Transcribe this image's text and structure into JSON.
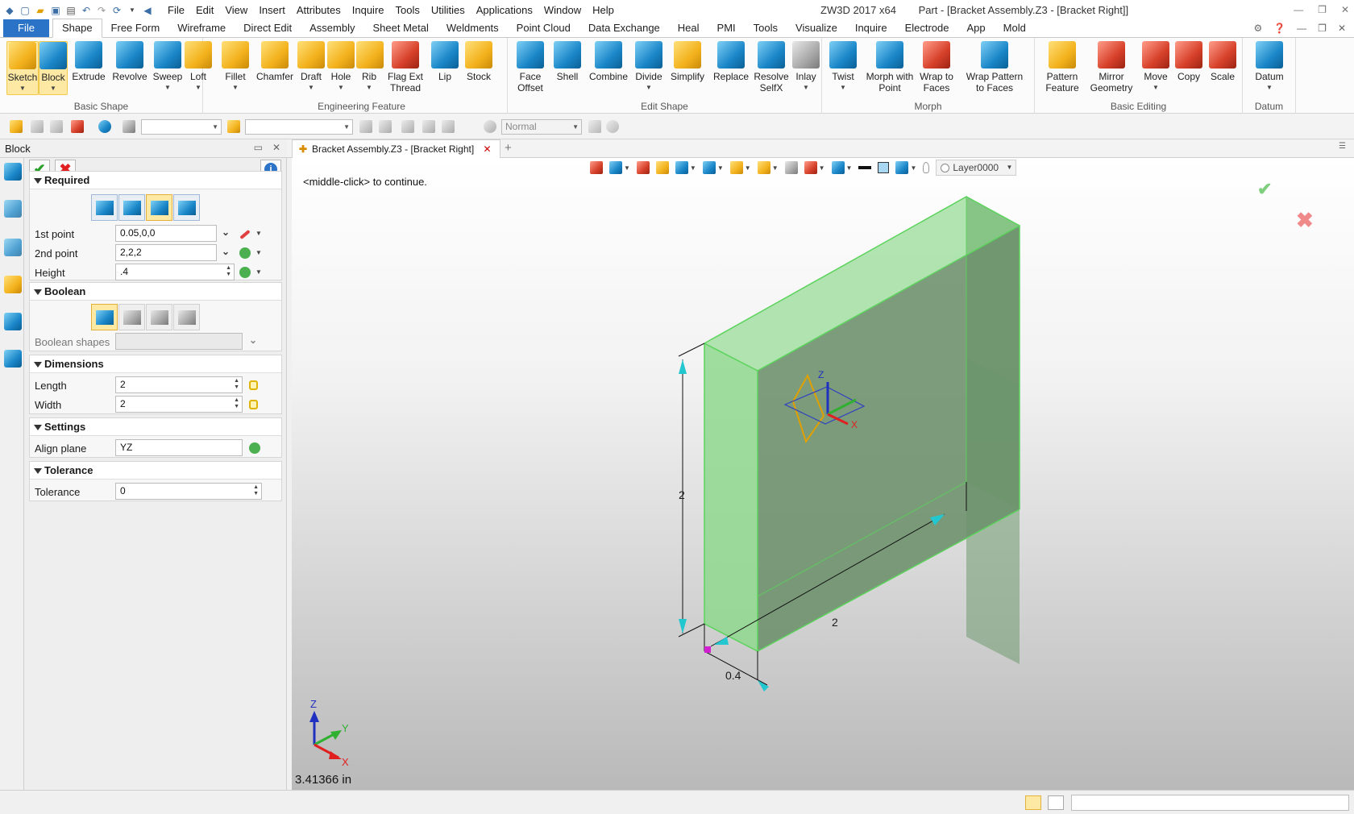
{
  "app": {
    "title": "ZW3D 2017  x64",
    "document_title": "Part - [Bracket Assembly.Z3 - [Bracket Right]]"
  },
  "menu": [
    "File",
    "Edit",
    "View",
    "Insert",
    "Attributes",
    "Inquire",
    "Tools",
    "Utilities",
    "Applications",
    "Window",
    "Help"
  ],
  "ribbon_tabs": [
    "File",
    "Shape",
    "Free Form",
    "Wireframe",
    "Direct Edit",
    "Assembly",
    "Sheet Metal",
    "Weldments",
    "Point Cloud",
    "Data Exchange",
    "Heal",
    "PMI",
    "Tools",
    "Visualize",
    "Inquire",
    "Electrode",
    "App",
    "Mold"
  ],
  "active_tab": "Shape",
  "ribbon": {
    "basic_shape": {
      "label": "Basic Shape",
      "buttons": [
        "Sketch",
        "Block",
        "Extrude",
        "Revolve",
        "Sweep",
        "Loft"
      ]
    },
    "engineering_feature": {
      "label": "Engineering Feature",
      "buttons": [
        "Fillet",
        "Chamfer",
        "Draft",
        "Hole",
        "Rib",
        "Flag Ext Thread",
        "Lip",
        "Stock"
      ]
    },
    "edit_shape": {
      "label": "Edit Shape",
      "buttons": [
        "Face Offset",
        "Shell",
        "Combine",
        "Divide",
        "Simplify",
        "Replace",
        "Resolve SelfX",
        "Inlay"
      ]
    },
    "morph": {
      "label": "Morph",
      "buttons": [
        "Twist",
        "Morph with Point",
        "Wrap to Faces",
        "Wrap Pattern to Faces"
      ]
    },
    "basic_editing": {
      "label": "Basic Editing",
      "buttons": [
        "Pattern Feature",
        "Mirror Geometry",
        "Move",
        "Copy",
        "Scale"
      ]
    },
    "datum": {
      "label": "Datum",
      "buttons": [
        "Datum"
      ]
    }
  },
  "toolbar": {
    "combo_render": "Normal"
  },
  "panel": {
    "title": "Block",
    "sections": {
      "required": "Required",
      "boolean": "Boolean",
      "dimensions": "Dimensions",
      "settings": "Settings",
      "tolerance": "Tolerance"
    },
    "fields": {
      "first_point": {
        "label": "1st point",
        "value": "0.05,0,0"
      },
      "second_point": {
        "label": "2nd point",
        "value": "2,2,2"
      },
      "height": {
        "label": "Height",
        "value": ".4"
      },
      "boolean_shapes": {
        "label": "Boolean shapes",
        "value": ""
      },
      "length": {
        "label": "Length",
        "value": "2"
      },
      "width": {
        "label": "Width",
        "value": "2"
      },
      "align_plane": {
        "label": "Align plane",
        "value": "YZ"
      },
      "tolerance": {
        "label": "Tolerance",
        "value": "0"
      }
    }
  },
  "document_tab": "Bracket Assembly.Z3 - [Bracket Right]",
  "viewport": {
    "prompt": "<middle-click> to continue.",
    "layer": "Layer0000",
    "coordinate_readout": "3.41366 in",
    "dimensions": {
      "height": "2",
      "length": "2",
      "thickness": "0.4"
    },
    "triad_labels": {
      "x": "X",
      "y": "Y",
      "z": "Z"
    },
    "shape_color": "#8fd88f",
    "edge_color": "#4caf50"
  }
}
